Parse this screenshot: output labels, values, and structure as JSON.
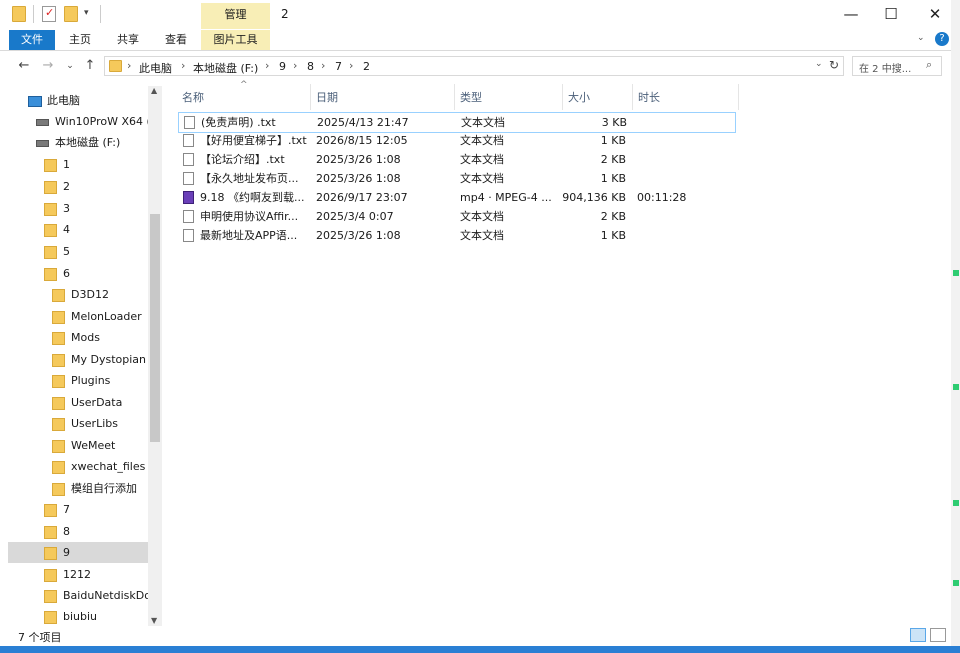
{
  "window": {
    "title": "2",
    "context_tab": "管理"
  },
  "ribbon": {
    "tabs": [
      "文件",
      "主页",
      "共享",
      "查看",
      "图片工具"
    ]
  },
  "address": {
    "crumbs": [
      "此电脑",
      "本地磁盘 (F:)",
      "9",
      "8",
      "7",
      "2"
    ],
    "search_placeholder": "在 2 中搜..."
  },
  "nav": {
    "items": [
      {
        "label": "此电脑",
        "icon": "pc-icon"
      },
      {
        "label": "Win10ProW X64 (C",
        "icon": "drive-icon"
      },
      {
        "label": "本地磁盘 (F:)",
        "icon": "drive-icon"
      },
      {
        "label": "1",
        "icon": "folder-icon"
      },
      {
        "label": "2",
        "icon": "folder-icon"
      },
      {
        "label": "3",
        "icon": "folder-icon"
      },
      {
        "label": "4",
        "icon": "folder-icon"
      },
      {
        "label": "5",
        "icon": "folder-icon"
      },
      {
        "label": "6",
        "icon": "folder-icon"
      },
      {
        "label": "D3D12",
        "icon": "folder-icon"
      },
      {
        "label": "MelonLoader",
        "icon": "folder-icon"
      },
      {
        "label": "Mods",
        "icon": "folder-icon"
      },
      {
        "label": "My Dystopian F",
        "icon": "folder-icon"
      },
      {
        "label": "Plugins",
        "icon": "folder-icon"
      },
      {
        "label": "UserData",
        "icon": "folder-icon"
      },
      {
        "label": "UserLibs",
        "icon": "folder-icon"
      },
      {
        "label": "WeMeet",
        "icon": "folder-icon"
      },
      {
        "label": "xwechat_files",
        "icon": "folder-icon"
      },
      {
        "label": "模组自行添加",
        "icon": "folder-icon"
      },
      {
        "label": "7",
        "icon": "folder-icon"
      },
      {
        "label": "8",
        "icon": "folder-icon"
      },
      {
        "label": "9",
        "icon": "folder-icon"
      },
      {
        "label": "1212",
        "icon": "folder-icon"
      },
      {
        "label": "BaiduNetdiskDoc",
        "icon": "folder-icon"
      },
      {
        "label": "biubiu",
        "icon": "folder-icon"
      }
    ]
  },
  "columns": {
    "name": "名称",
    "date": "日期",
    "type": "类型",
    "size": "大小",
    "duration": "时长"
  },
  "files": [
    {
      "name": "(免责声明) .txt",
      "date": "2025/4/13 21:47",
      "type": "文本文档",
      "size": "3 KB",
      "duration": "",
      "icon": "text-file-icon"
    },
    {
      "name": "【好用便宜梯子】.txt",
      "date": "2026/8/15 12:05",
      "type": "文本文档",
      "size": "1 KB",
      "duration": "",
      "icon": "text-file-icon"
    },
    {
      "name": "【论坛介绍】.txt",
      "date": "2025/3/26 1:08",
      "type": "文本文档",
      "size": "2 KB",
      "duration": "",
      "icon": "text-file-icon"
    },
    {
      "name": "【永久地址发布页...",
      "date": "2025/3/26 1:08",
      "type": "文本文档",
      "size": "1 KB",
      "duration": "",
      "icon": "text-file-icon"
    },
    {
      "name": "9.18 《约啊友到载...",
      "date": "2026/9/17 23:07",
      "type": "mp4 · MPEG-4 ...",
      "size": "904,136 KB",
      "duration": "00:11:28",
      "icon": "video-file-icon"
    },
    {
      "name": "申明使用协议Affir...",
      "date": "2025/3/4 0:07",
      "type": "文本文档",
      "size": "2 KB",
      "duration": "",
      "icon": "text-file-icon"
    },
    {
      "name": "最新地址及APP语...",
      "date": "2025/3/26 1:08",
      "type": "文本文档",
      "size": "1 KB",
      "duration": "",
      "icon": "text-file-icon"
    }
  ],
  "status": {
    "count": "7 个项目"
  }
}
